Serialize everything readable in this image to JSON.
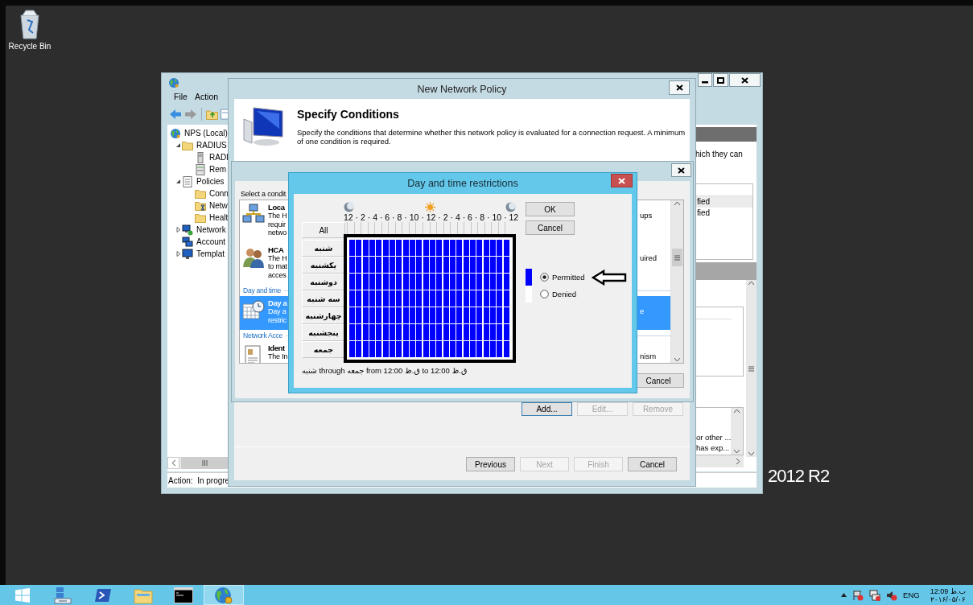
{
  "desktop": {
    "icons": [
      {
        "label": "Recycle Bin"
      }
    ],
    "edition": "2012 R2"
  },
  "mmc": {
    "menu": [
      "File",
      "Action"
    ],
    "tree": [
      {
        "label": "NPS (Local)",
        "children": [
          {
            "label": "RADIUS",
            "expanded": true,
            "children": [
              {
                "label": "RADI"
              },
              {
                "label": "Rem"
              }
            ]
          },
          {
            "label": "Policies",
            "expanded": true,
            "children": [
              {
                "label": "Conn"
              },
              {
                "label": "Netw"
              },
              {
                "label": "Healt"
              }
            ]
          },
          {
            "label": "Network",
            "expanded": false
          },
          {
            "label": "Account"
          },
          {
            "label": "Templat",
            "expanded": false
          }
        ]
      }
    ],
    "right_pane": {
      "description": "hich they can",
      "table_rows": [
        "fied",
        "fied"
      ],
      "list_rows": [
        "or other ...",
        "has exp..."
      ]
    },
    "status": "Action:  In progre"
  },
  "policy_wizard": {
    "title": "New Network Policy",
    "heading": "Specify Conditions",
    "description": "Specify the conditions that determine whether this network policy is evaluated for a connection request. A minimum of one condition is required.",
    "actions": [
      {
        "label": "Add...",
        "disabled": false
      },
      {
        "label": "Edit...",
        "disabled": true
      },
      {
        "label": "Remove",
        "disabled": true
      }
    ],
    "buttons": [
      {
        "label": "Previous",
        "disabled": false
      },
      {
        "label": "Next",
        "disabled": true
      },
      {
        "label": "Finish",
        "disabled": true
      },
      {
        "label": "Cancel",
        "disabled": false
      }
    ]
  },
  "select_condition": {
    "prompt": "Select a condit",
    "items": [
      {
        "kind": "item",
        "title": "Loca",
        "lines": [
          "The H",
          "requir",
          "netwo"
        ],
        "tail": "ups",
        "selected": false
      },
      {
        "kind": "item",
        "title": "HCA",
        "lines": [
          "The H",
          "to mat",
          "acces"
        ],
        "tail": "uired",
        "selected": false
      },
      {
        "kind": "group",
        "label": "Day and time"
      },
      {
        "kind": "item",
        "title": "Day a",
        "lines": [
          "Day a",
          "restric"
        ],
        "tail": "e",
        "selected": true
      },
      {
        "kind": "group",
        "label": "Network Acce"
      },
      {
        "kind": "item",
        "title": "Ident",
        "lines": [
          "The In"
        ],
        "tail": "nism",
        "selected": false
      }
    ],
    "buttons": [
      "Cancel"
    ]
  },
  "day_time": {
    "title": "Day and time restrictions",
    "hours": "12 · 2 · 4 · 6 · 8 · 10 · 12 · 2 · 4 · 6 · 8 · 10 · 12",
    "all": "All",
    "days": [
      {
        "label": "شنبه",
        "permitted": true
      },
      {
        "label": "یکشنبه",
        "permitted": true
      },
      {
        "label": "دوشنبه",
        "permitted": true
      },
      {
        "label": "سه شنبه",
        "permitted": true
      },
      {
        "label": "چهارشنبه",
        "permitted": true
      },
      {
        "label": "پنجشنبه",
        "permitted": true
      },
      {
        "label": "جمعه",
        "permitted": true
      }
    ],
    "summary": "شنبه through جمعه from 12:00 ق.ظ to 12:00 ق.ظ",
    "buttons": [
      "OK",
      "Cancel"
    ],
    "options": [
      {
        "label": "Permitted",
        "selected": true
      },
      {
        "label": "Denied",
        "selected": false
      }
    ]
  },
  "taskbar": {
    "apps": [
      {
        "kind": "start",
        "active": false
      },
      {
        "kind": "server-manager",
        "active": false
      },
      {
        "kind": "powershell",
        "active": false
      },
      {
        "kind": "explorer",
        "active": false
      },
      {
        "kind": "command-prompt",
        "active": false
      },
      {
        "kind": "nps",
        "active": true
      }
    ],
    "tray": {
      "language": "ENG",
      "time": "12:09 ب.ظ",
      "date": "۲۰۱۶/۰۵/۰۶"
    }
  }
}
